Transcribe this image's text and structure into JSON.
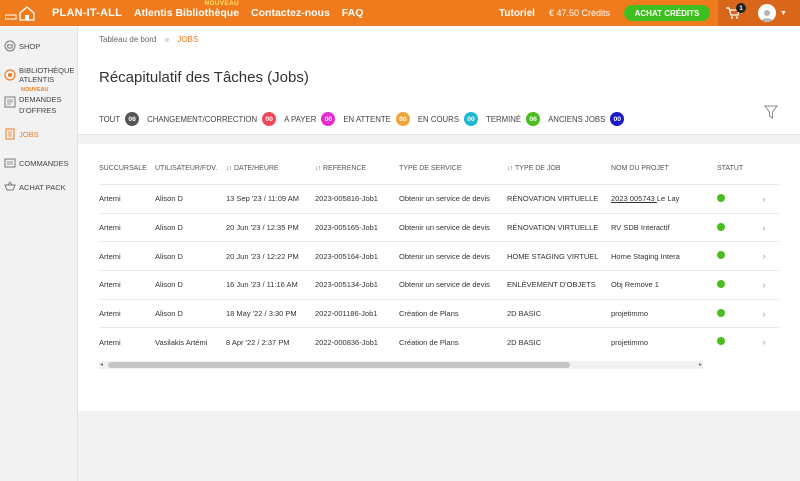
{
  "header": {
    "brand": "PLAN-IT-ALL",
    "nav": [
      {
        "label": "Atlentis Bibliothèque",
        "badge": "NOUVEAU"
      },
      {
        "label": "Contactez-nous"
      },
      {
        "label": "FAQ"
      }
    ],
    "tutorial": "Tutoriel",
    "credits": "€ 47.50 Crédits",
    "buy_credits": "ACHAT CRÉDITS",
    "cart_count": "1"
  },
  "sidebar": {
    "items": [
      {
        "label": "SHOP",
        "icon": "shop-icon"
      },
      {
        "label": "BIBLIOTHÈQUE ATLENTIS",
        "badge": "NOUVEAU",
        "icon": "library-icon"
      },
      {
        "label": "DEMANDES D'OFFRES",
        "icon": "offers-icon"
      },
      {
        "label": "JOBS",
        "icon": "jobs-icon",
        "active": true
      },
      {
        "label": "COMMANDES",
        "icon": "orders-icon"
      },
      {
        "label": "ACHAT PACK",
        "icon": "pack-icon"
      }
    ]
  },
  "breadcrumb": {
    "home": "Tableau de bord",
    "separator": "»",
    "current": "JOBS"
  },
  "page_title": "Récapitulatif des Tâches (Jobs)",
  "tabs": [
    {
      "label": "TOUT",
      "count": "06",
      "color": "#555555",
      "active": true
    },
    {
      "label": "CHANGEMENT/CORRECTION",
      "count": "00",
      "color": "#f0465a"
    },
    {
      "label": "A PAYER",
      "count": "00",
      "color": "#e62ad1"
    },
    {
      "label": "EN ATTENTE",
      "count": "00",
      "color": "#f2a33a"
    },
    {
      "label": "EN COURS",
      "count": "00",
      "color": "#1fb8d4"
    },
    {
      "label": "TERMINÉ",
      "count": "06",
      "color": "#4cbd1f"
    },
    {
      "label": "ANCIENS JOBS",
      "count": "00",
      "color": "#1a1ac7"
    }
  ],
  "table": {
    "headers": [
      "SUCCURSALE",
      "UTILISATEUR/FDV.",
      "DATE/HEURE",
      "REFERENCE",
      "TYPE DE SERVICE",
      "TYPE DE JOB",
      "NOM DU PROJET",
      "STATUT"
    ],
    "rows": [
      {
        "succursale": "Artemi",
        "user": "Alison D",
        "date": "13 Sep '23 / 11:09 AM",
        "ref": "2023-005816-Job1",
        "service": "Obtenir un service de devis",
        "job": "RÉNOVATION VIRTUELLE",
        "project_link": "2023 005743 ",
        "project": "Le Lay",
        "status_color": "#4cbd1f"
      },
      {
        "succursale": "Artemi",
        "user": "Alison D",
        "date": "20 Jun '23 / 12:35 PM",
        "ref": "2023-005165-Job1",
        "service": "Obtenir un service de devis",
        "job": "RÉNOVATION VIRTUELLE",
        "project_link": "",
        "project": "RV SDB Interactif",
        "status_color": "#4cbd1f"
      },
      {
        "succursale": "Artemi",
        "user": "Alison D",
        "date": "20 Jun '23 / 12:22 PM",
        "ref": "2023-005164-Job1",
        "service": "Obtenir un service de devis",
        "job": "HOME STAGING VIRTUEL",
        "project_link": "",
        "project": "Home Staging Intera",
        "status_color": "#4cbd1f"
      },
      {
        "succursale": "Artemi",
        "user": "Alison D",
        "date": "16 Jun '23 / 11:16 AM",
        "ref": "2023-005134-Job1",
        "service": "Obtenir un service de devis",
        "job": "ENLÈVEMENT D'OBJETS",
        "project_link": "",
        "project": "Obj Remove 1",
        "status_color": "#4cbd1f"
      },
      {
        "succursale": "Artemi",
        "user": "Alison D",
        "date": "18 May '22 / 3:30 PM",
        "ref": "2022-001186-Job1",
        "service": "Création de Plans",
        "job": "2D BASIC",
        "project_link": "",
        "project": "projetimmo",
        "status_color": "#4cbd1f"
      },
      {
        "succursale": "Artemi",
        "user": "Vasilakis Artémi",
        "date": "8 Apr '22 / 2:37 PM",
        "ref": "2022-000836-Job1",
        "service": "Création de Plans",
        "job": "2D BASIC",
        "project_link": "",
        "project": "projetimmo",
        "status_color": "#4cbd1f"
      }
    ]
  }
}
